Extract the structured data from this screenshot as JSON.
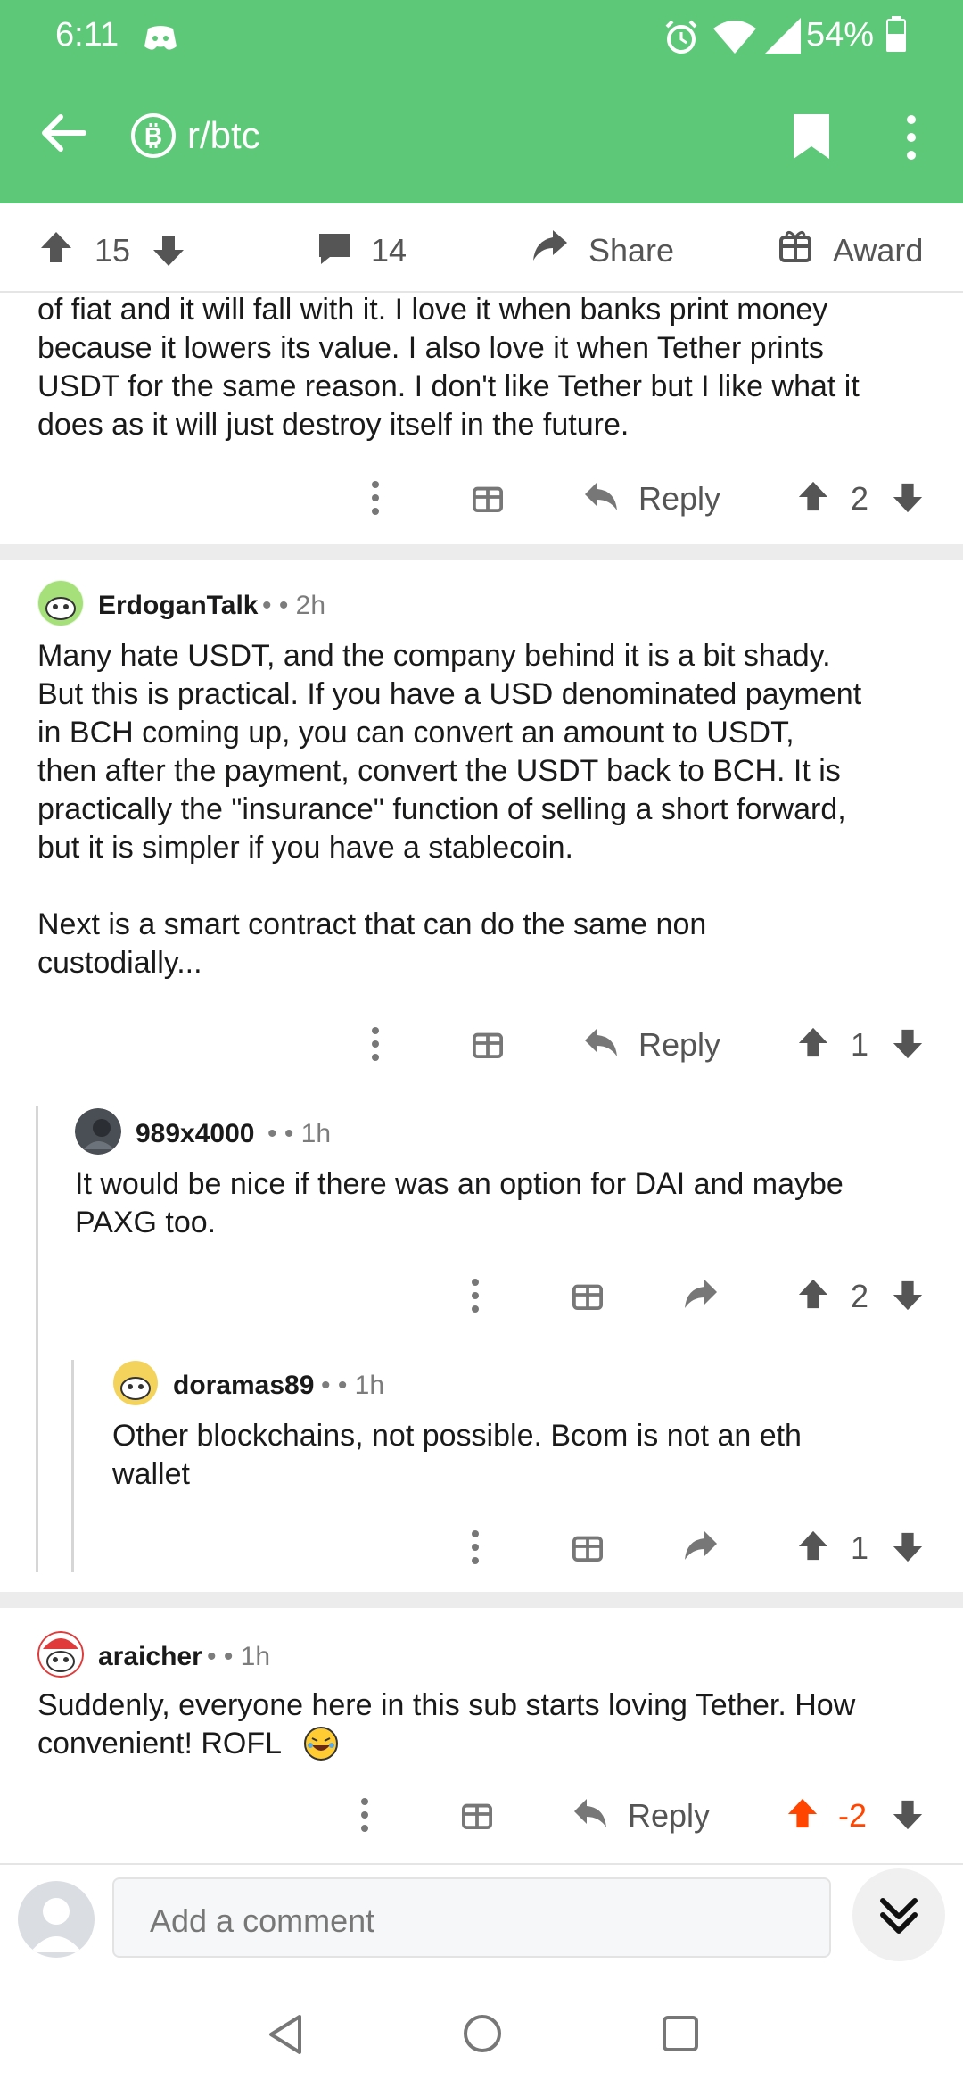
{
  "status": {
    "time": "6:11",
    "battery": "54%"
  },
  "header": {
    "subreddit": "r/btc"
  },
  "post_actions": {
    "upvotes": "15",
    "comments": "14",
    "share_label": "Share",
    "award_label": "Award"
  },
  "comments": [
    {
      "text": "of fiat and it will fall with it. I love it when banks print money\nbecause it lowers its value. I also love it when Tether prints\nUSDT for the same reason. I don't like Tether but I like what it\ndoes as it will just destroy itself in the future.",
      "reply_label": "Reply",
      "score": "2"
    },
    {
      "author": "ErdoganTalk",
      "meta": "• • 2h",
      "text": "Many hate USDT, and the company behind it is a bit shady.\nBut this is practical. If you have a USD denominated payment\nin BCH coming up, you can convert an amount to USDT,\nthen after the payment, convert the USDT back to BCH. It is\npractically the \"insurance\" function of selling a short forward,\nbut it is simpler if you have a stablecoin.\n\nNext is a smart contract that can do the same non\ncustodially...",
      "reply_label": "Reply",
      "score": "1"
    },
    {
      "author": "989x4000",
      "meta": "• • 1h",
      "text": "It would be nice if there was an option for DAI and maybe\nPAXG too.",
      "score": "2"
    },
    {
      "author": "doramas89",
      "meta": "• • 1h",
      "text": "Other blockchains, not possible. Bcom is not an eth\nwallet",
      "score": "1"
    },
    {
      "author": "araicher",
      "meta": "• • 1h",
      "text": "Suddenly, everyone here in this sub starts loving Tether. How\nconvenient! ROFL",
      "reply_label": "Reply",
      "score": "-2"
    }
  ],
  "composer": {
    "placeholder": "Add a comment"
  },
  "colors": {
    "header": "#5cc878",
    "downvote_orange": "#ff4500",
    "text": "#1a1a1b"
  }
}
